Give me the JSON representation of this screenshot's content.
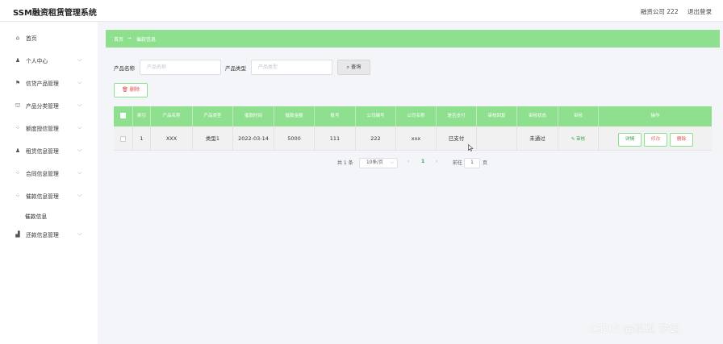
{
  "app": {
    "title": "SSM融资租赁管理系统"
  },
  "header": {
    "user": "融资公司 222",
    "logout": "退出登录"
  },
  "sidebar": {
    "items": [
      {
        "label": "首页",
        "icon": "home-icon",
        "glyph": "⌂",
        "chevron": false
      },
      {
        "label": "个人中心",
        "icon": "user-icon",
        "glyph": "♟",
        "chevron": true
      },
      {
        "label": "信贷产品管理",
        "icon": "flag-icon",
        "glyph": "⚑",
        "chevron": true
      },
      {
        "label": "产品分类管理",
        "icon": "bank-icon",
        "glyph": "⛫",
        "chevron": true
      },
      {
        "label": "额度授信管理",
        "icon": "grid-icon",
        "glyph": "⁘",
        "chevron": true
      },
      {
        "label": "租赁信息管理",
        "icon": "user-icon",
        "glyph": "♟",
        "chevron": true
      },
      {
        "label": "合同信息管理",
        "icon": "grid-icon",
        "glyph": "⁘",
        "chevron": true
      },
      {
        "label": "催款信息管理",
        "icon": "grid-icon",
        "glyph": "⁘",
        "chevron": true
      },
      {
        "label": "还款信息管理",
        "icon": "chart-icon",
        "glyph": "▟",
        "chevron": true
      }
    ],
    "active_sub": "催款信息"
  },
  "breadcrumb": {
    "home": "首页",
    "separator": "➙",
    "current": "催款信息"
  },
  "search": {
    "name_label": "产品名称",
    "name_placeholder": "产品名称",
    "type_label": "产品类型",
    "type_placeholder": "产品类型",
    "button": "查询"
  },
  "toolbar": {
    "delete_label": "删除"
  },
  "table": {
    "headers": [
      "索引",
      "产品名称",
      "产品类型",
      "催款时间",
      "催款金额",
      "账号",
      "公司编号",
      "公司名称",
      "是否支付",
      "审核回复",
      "审核状态",
      "审核",
      "操作"
    ],
    "rows": [
      {
        "index": "1",
        "product_name": "XXX",
        "product_type": "类型1",
        "time": "2022-03-14",
        "amount": "5000",
        "account": "111",
        "company_no": "222",
        "company_name": "xxx",
        "paid": "已支付",
        "reply": "",
        "status": "未通过",
        "audit": "审核",
        "actions": [
          "详情",
          "修改",
          "删除"
        ]
      }
    ]
  },
  "pagination": {
    "total": "共 1 条",
    "page_size": "10条/页",
    "prev": "‹",
    "page": "1",
    "next": "›",
    "goto_label": "前往",
    "goto_value": "1",
    "goto_suffix": "页"
  },
  "watermark": "CSDN @琪琪 学姐",
  "colors": {
    "accent": "#8ee08f",
    "danger": "#e04b4b",
    "success": "#3aa35a",
    "text": "#333333"
  }
}
